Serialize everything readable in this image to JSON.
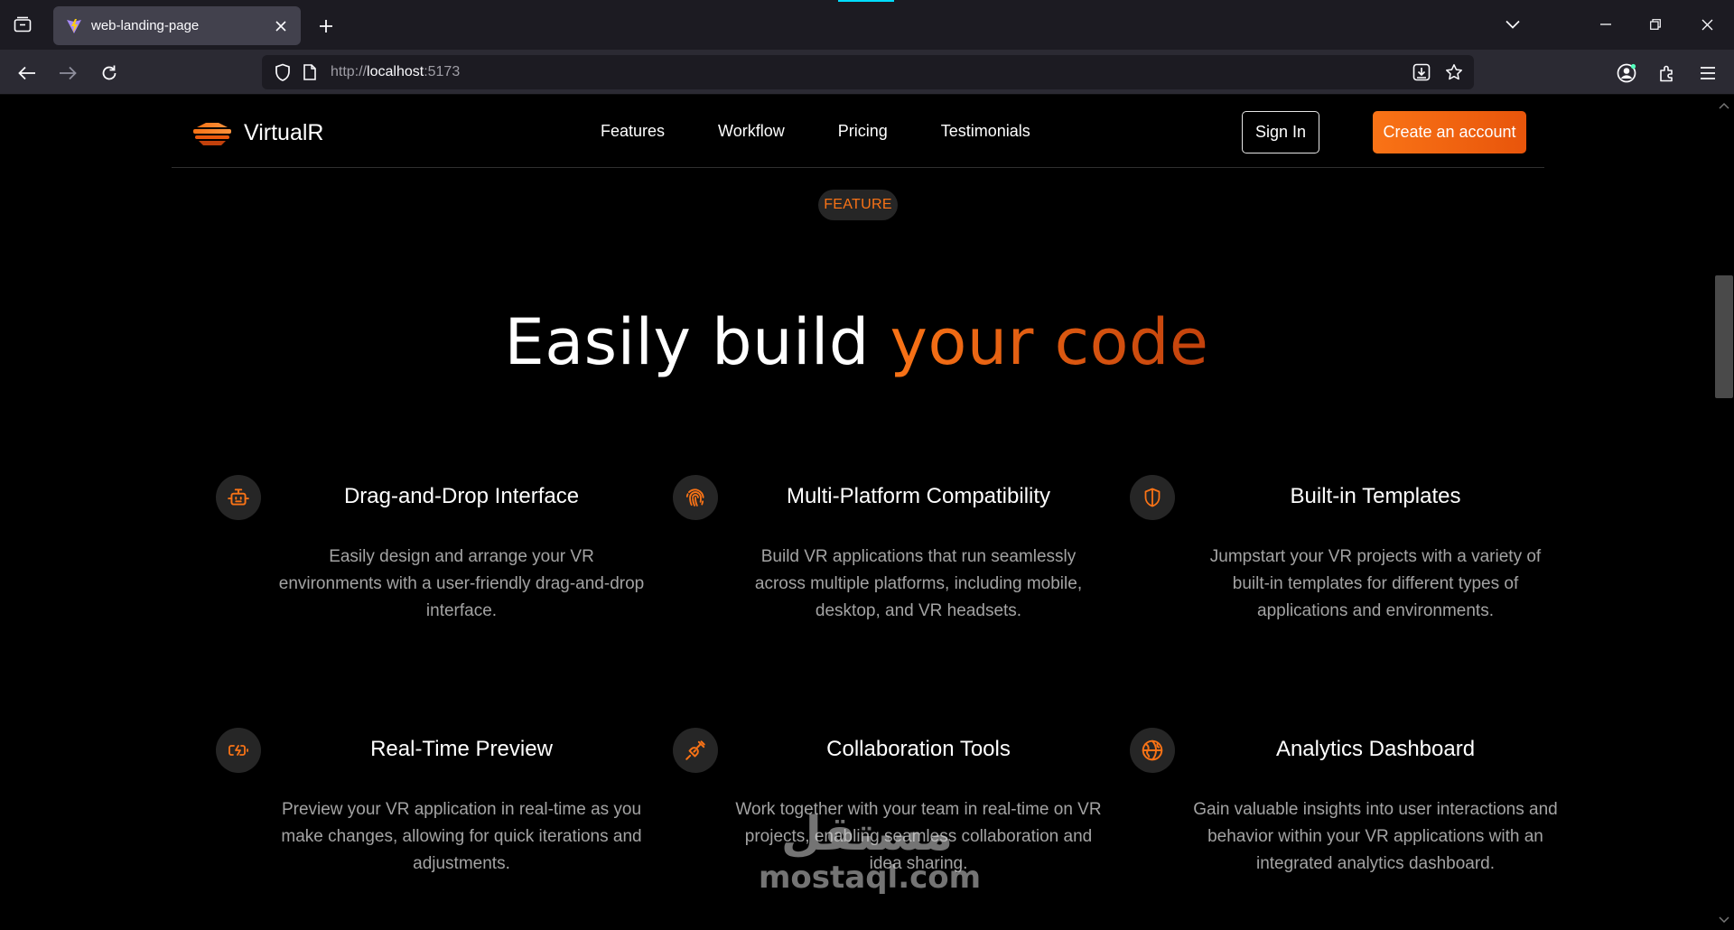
{
  "browser": {
    "tab_title": "web-landing-page",
    "url_prefix": "http://",
    "url_host": "localhost",
    "url_port": ":5173",
    "icons": [
      "tab-list-icon",
      "new-tab-icon",
      "list-all-tabs-icon",
      "minimize-icon",
      "restore-icon",
      "close-icon",
      "back-icon",
      "forward-icon",
      "reload-icon",
      "shield-icon",
      "page-icon",
      "save-page-icon",
      "bookmark-star-icon",
      "account-icon",
      "extensions-icon",
      "menu-icon"
    ]
  },
  "nav": {
    "brand": "VirtualR",
    "links": [
      "Features",
      "Workflow",
      "Pricing",
      "Testimonials"
    ],
    "sign_in": "Sign In",
    "create_account": "Create an account"
  },
  "hero": {
    "badge": "FEATURE",
    "title_plain": "Easily build ",
    "title_accent": "your code"
  },
  "features": [
    {
      "icon": "robot-icon",
      "title": "Drag-and-Drop Interface",
      "description": "Easily design and arrange your VR environments with a user-friendly drag-and-drop interface."
    },
    {
      "icon": "fingerprint-icon",
      "title": "Multi-Platform Compatibility",
      "description": "Build VR applications that run seamlessly across multiple platforms, including mobile, desktop, and VR headsets."
    },
    {
      "icon": "shield-half-icon",
      "title": "Built-in Templates",
      "description": "Jumpstart your VR projects with a variety of built-in templates for different types of applications and environments."
    },
    {
      "icon": "battery-charging-icon",
      "title": "Real-Time Preview",
      "description": "Preview your VR application in real-time as you make changes, allowing for quick iterations and adjustments."
    },
    {
      "icon": "plug-icon",
      "title": "Collaboration Tools",
      "description": "Work together with your team in real-time on VR projects, enabling seamless collaboration and idea sharing."
    },
    {
      "icon": "globe-icon",
      "title": "Analytics Dashboard",
      "description": "Gain valuable insights into user interactions and behavior within your VR applications with an integrated analytics dashboard."
    }
  ],
  "watermark": {
    "arabic": "مستقل",
    "latin": "mostaql.com"
  },
  "colors": {
    "accent": "#f97316",
    "accent_dark": "#c2410c",
    "background": "#000000",
    "muted_text": "#a3a3a3"
  }
}
